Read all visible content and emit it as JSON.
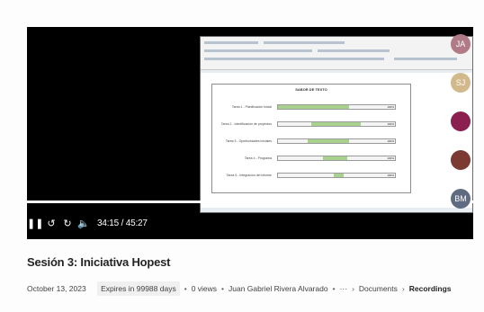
{
  "player": {
    "current_time": "34:15 / 45:27",
    "progress_fraction": 0.754,
    "controls": {
      "play_icon": "pause-icon",
      "rewind_icon": "rewind-10-icon",
      "forward_icon": "forward-10-icon",
      "volume_icon": "volume-icon"
    }
  },
  "shared_screen": {
    "chart_data": {
      "type": "bar",
      "title": "SABOR DE TEXTO",
      "categories": [
        "Tarea 1 - Planificación inicial",
        "Tarea 2 - Identificación de proyectos",
        "Tarea 3 - Oportunidades iniciales",
        "Tarea 4 - Programa",
        "Tarea 5 - Integración del informe"
      ],
      "start": [
        0.0,
        0.28,
        0.25,
        0.38,
        0.47
      ],
      "length": [
        0.6,
        0.42,
        0.35,
        0.2,
        0.08
      ],
      "percent_labels": [
        "100%",
        "100%",
        "100%",
        "100%",
        "100%"
      ],
      "xlim": [
        0,
        1
      ]
    }
  },
  "participants": [
    {
      "initials": "JA",
      "color": "#b07b86"
    },
    {
      "initials": "SJ",
      "color": "#d1b98b"
    },
    {
      "initials": "",
      "color": "#8b1f4f"
    },
    {
      "initials": "",
      "color": "#7b3b32"
    },
    {
      "initials": "BM",
      "color": "#5f6b80"
    }
  ],
  "recording": {
    "title": "Sesión 3: Iniciativa Hopest",
    "date": "October 13, 2023",
    "expires": "Expires in 99988 days",
    "views": "0 views",
    "owner": "Juan Gabriel Rivera Alvarado",
    "more": "···",
    "breadcrumb": [
      "Documents",
      "Recordings"
    ]
  }
}
